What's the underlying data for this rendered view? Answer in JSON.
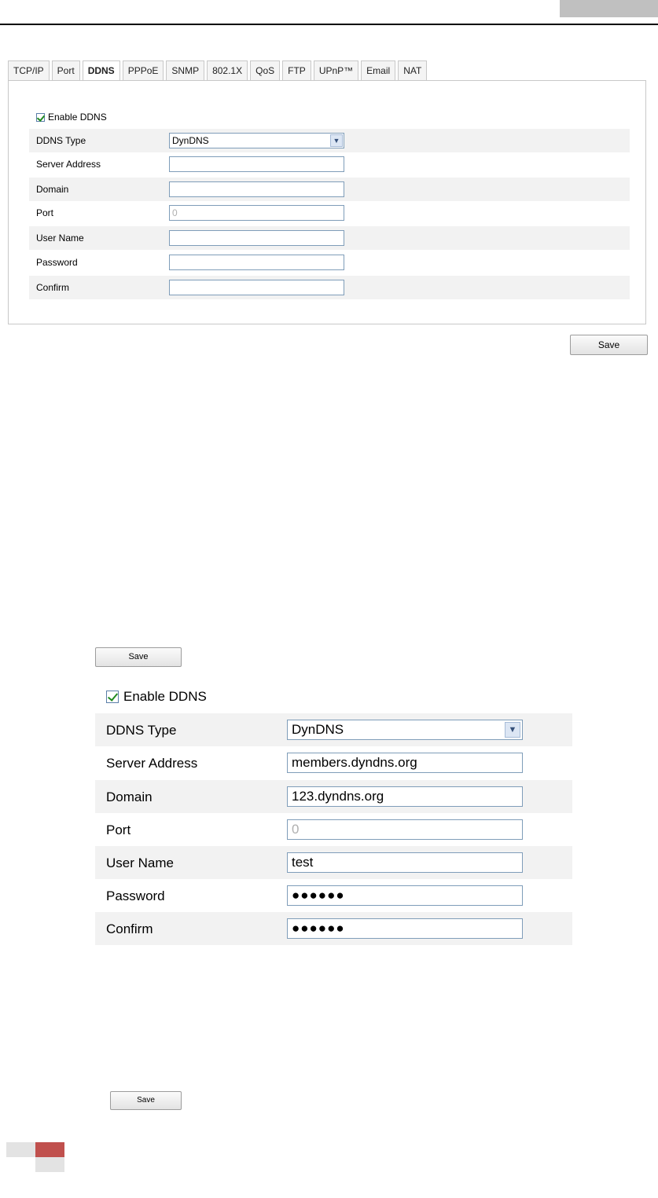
{
  "tabs": [
    "TCP/IP",
    "Port",
    "DDNS",
    "PPPoE",
    "SNMP",
    "802.1X",
    "QoS",
    "FTP",
    "UPnP™",
    "Email",
    "NAT"
  ],
  "active_tab": "DDNS",
  "form_small": {
    "enable_label": "Enable DDNS",
    "enabled": true,
    "rows": [
      {
        "label": "DDNS Type",
        "value": "DynDNS",
        "type": "select"
      },
      {
        "label": "Server Address",
        "value": ""
      },
      {
        "label": "Domain",
        "value": ""
      },
      {
        "label": "Port",
        "value": "0",
        "disabled": true
      },
      {
        "label": "User Name",
        "value": ""
      },
      {
        "label": "Password",
        "value": ""
      },
      {
        "label": "Confirm",
        "value": ""
      }
    ],
    "save_label": "Save"
  },
  "save_mid_label": "Save",
  "form_large": {
    "enable_label": "Enable DDNS",
    "enabled": true,
    "rows": [
      {
        "label": "DDNS Type",
        "value": "DynDNS",
        "type": "select"
      },
      {
        "label": "Server Address",
        "value": "members.dyndns.org"
      },
      {
        "label": "Domain",
        "value": "123.dyndns.org"
      },
      {
        "label": "Port",
        "value": "0",
        "disabled": true
      },
      {
        "label": "User Name",
        "value": "test"
      },
      {
        "label": "Password",
        "value": "●●●●●●",
        "masked": true
      },
      {
        "label": "Confirm",
        "value": "●●●●●●",
        "masked": true
      }
    ]
  },
  "save_bottom_label": "Save",
  "colors": {
    "accent": "#c0504d",
    "header_box": "#c0c0c0",
    "row_shade": "#f2f2f2"
  }
}
